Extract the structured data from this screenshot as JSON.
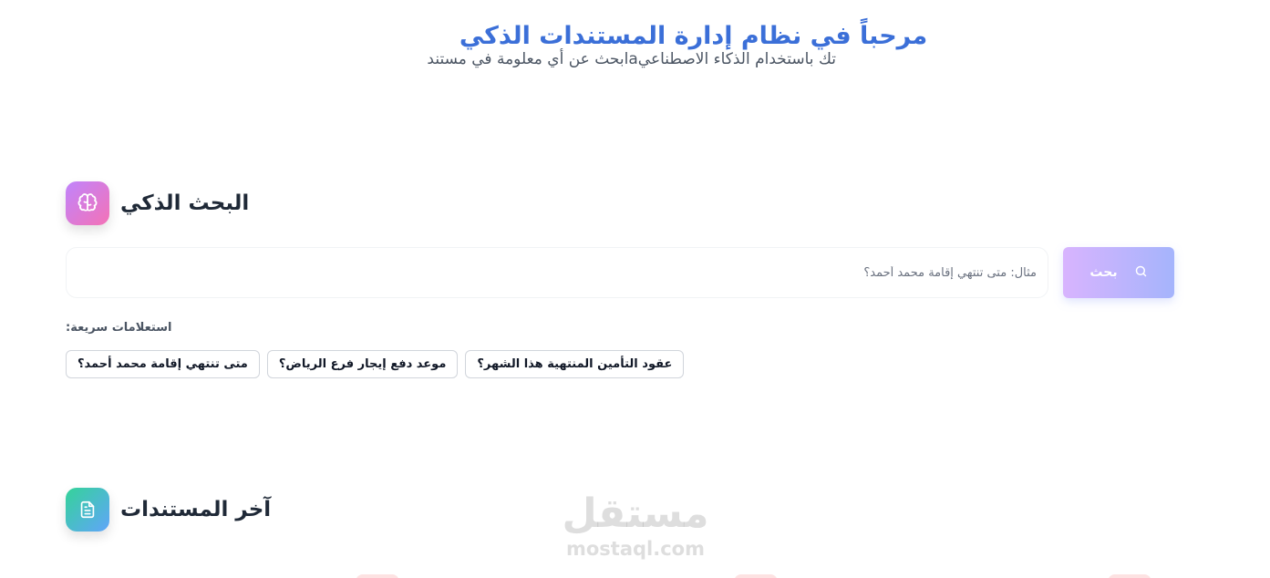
{
  "hero": {
    "title": "مرحباً في نظام إدارة المستندات الذكي",
    "subtitle": "تك باستخدام الذكاء الاصطناعيaابحث عن أي معلومة في مستند"
  },
  "smart_search": {
    "title": "البحث الذكي",
    "icon": "brain-icon",
    "placeholder": "مثال: متى تنتهي إقامة محمد أحمد؟",
    "value": "",
    "button_label": "بحث",
    "button_icon": "search-icon"
  },
  "quick_queries": {
    "label": "استعلامات سريعة:",
    "items": [
      "عقود التأمين المنتهية هذا الشهر؟",
      "موعد دفع إيجار فرع الرياض؟",
      "متى تنتهي إقامة محمد أحمد؟"
    ]
  },
  "recent_docs": {
    "title": "آخر المستندات",
    "icon": "document-icon"
  },
  "watermark": {
    "arabic": "مستقل",
    "latin": "mostaql.com"
  },
  "colors": {
    "accent": "#3b6fd8",
    "search_button_from": "#d8b4fe",
    "search_button_to": "#a5b4fc",
    "ai_icon_from": "#c084fc",
    "ai_icon_to": "#f472b6",
    "docs_icon_from": "#34d399",
    "docs_icon_to": "#60a5fa"
  }
}
